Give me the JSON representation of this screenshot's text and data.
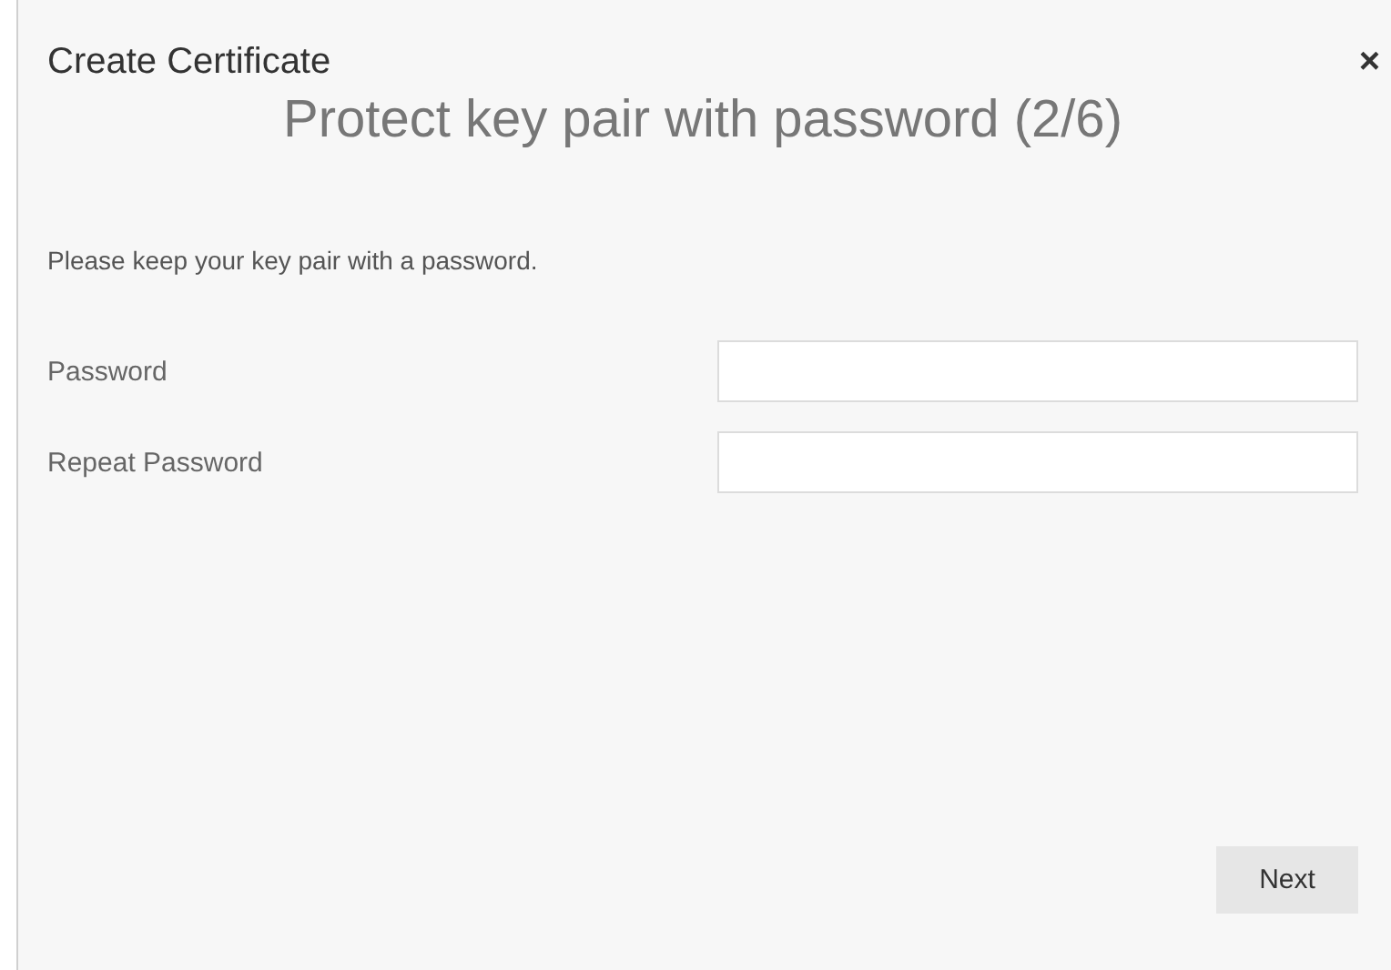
{
  "dialog": {
    "title": "Create Certificate",
    "close": "×"
  },
  "heading": "Protect key pair with password (2/6)",
  "intro": "Please keep your key pair with a password.",
  "fields": [
    {
      "label": "Password"
    },
    {
      "label": "Repeat Password"
    }
  ],
  "buttons": [
    {
      "label": "Next"
    }
  ]
}
